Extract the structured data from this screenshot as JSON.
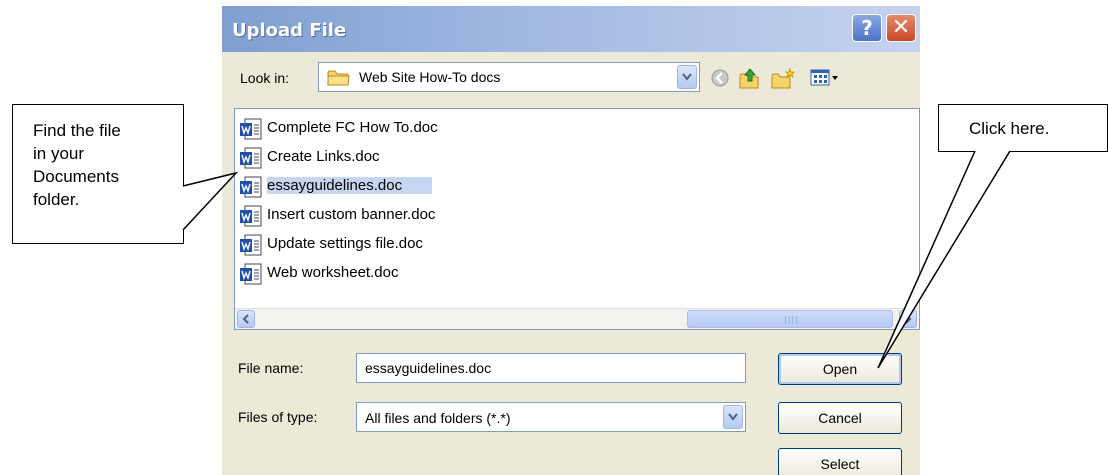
{
  "dialog": {
    "title": "Upload File",
    "help_icon": "help-icon",
    "close_icon": "close-icon",
    "look_in_label": "Look in:",
    "look_in_value": "Web Site How-To docs",
    "toolbar_icons": [
      "back-icon",
      "up-folder-icon",
      "new-folder-icon",
      "view-menu-icon"
    ],
    "files": [
      {
        "name": "Complete FC How To.doc",
        "icon": "word-doc-icon",
        "selected": false
      },
      {
        "name": "Create Links.doc",
        "icon": "word-doc-icon",
        "selected": false
      },
      {
        "name": "essayguidelines.doc",
        "icon": "word-doc-icon",
        "selected": true
      },
      {
        "name": "Insert custom banner.doc",
        "icon": "word-doc-icon",
        "selected": false
      },
      {
        "name": "Update settings file.doc",
        "icon": "word-doc-icon",
        "selected": false
      },
      {
        "name": "Web worksheet.doc",
        "icon": "word-doc-icon",
        "selected": false
      }
    ],
    "file_name_label": "File name:",
    "file_name_value": "essayguidelines.doc",
    "file_type_label": "Files of type:",
    "file_type_value": "All files and folders (*.*)",
    "buttons": {
      "open": "Open",
      "cancel": "Cancel",
      "select": "Select"
    }
  },
  "callouts": {
    "left": "Find the file\nin your\nDocuments\nfolder.",
    "right": "Click here."
  },
  "colors": {
    "title_gradient_start": "#7f9fd0",
    "title_gradient_end": "#c6d3ef",
    "dialog_bg": "#ece9d8",
    "selection": "#c6d6f2",
    "close_button": "#c8492a"
  }
}
